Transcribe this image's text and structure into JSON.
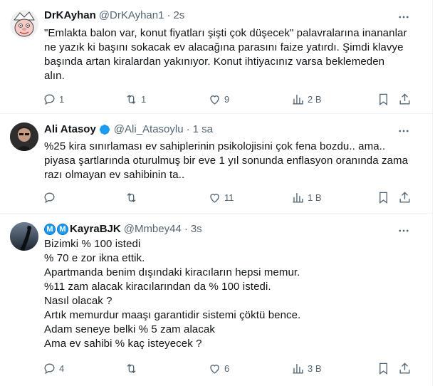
{
  "tweets": [
    {
      "name": "DrKAyhan",
      "handle": "@DrKAyhan1",
      "time": "2s",
      "lines": [
        "\"Emlakta balon var, konut fiyatları şişti çok düşecek\" palavralarına inananlar",
        "ne yazık ki başını sokacak ev alacağına parasını faize yatırdı. Şimdi klavye",
        "başında artan kiralardan  yakınıyor. Konut ihtiyacınız varsa beklemeden",
        "alın."
      ],
      "replies": "1",
      "retweets": "1",
      "likes": "9",
      "views": "2 B"
    },
    {
      "name": "Ali Atasoy",
      "handle": "@Ali_Atasoylu",
      "time": "1 sa",
      "lines": [
        "%25 kira sınırlaması ev sahiplerinin psikolojisini çok fena bozdu.. ama..",
        "piyasa şartlarında oturulmuş bir eve 1 yıl sonunda enflasyon oranında zama",
        "razı olmayan ev sahibinin ta.."
      ],
      "replies": "",
      "retweets": "",
      "likes": "11",
      "views": "1 B"
    },
    {
      "name_prefix": [
        "M",
        "M"
      ],
      "name": "KayraBJK",
      "handle": "@Mmbey44",
      "time": "3s",
      "lines": [
        "Bizimki % 100 istedi",
        "% 70 e zor ikna ettik.",
        "Apartmanda benim dışındaki kiracıların hepsi memur.",
        "%11 zam alacak kiracılarından da % 100 istedi.",
        "Nasıl olacak ?",
        "Artık memurdur maaşı garantidir sistemi çöktü bence.",
        "Adam seneye belki % 5 zam alacak",
        "Ama ev sahibi % kaç isteyecek ?"
      ],
      "replies": "4",
      "retweets": "",
      "likes": "6",
      "views": "3 B"
    }
  ],
  "colors": {
    "text": "#0f1419",
    "muted": "#536471",
    "verified": "#1d9bf0",
    "border": "#eff3f4"
  },
  "icons": [
    "more-icon",
    "reply-icon",
    "retweet-icon",
    "like-icon",
    "views-icon",
    "bookmark-icon",
    "share-icon",
    "verified-icon"
  ]
}
